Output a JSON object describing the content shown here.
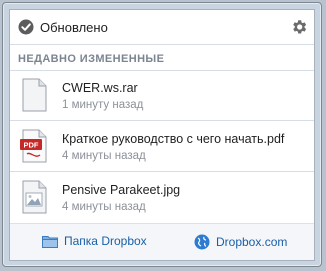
{
  "status": {
    "text": "Обновлено",
    "icon": "check-circle-icon"
  },
  "settings": {
    "icon": "gear-icon"
  },
  "recent": {
    "title": "НЕДАВНО ИЗМЕНЕННЫЕ",
    "files": [
      {
        "name": "CWER.ws.rar",
        "time": "1 минуту назад",
        "icon": "generic-file-icon"
      },
      {
        "name": "Краткое руководство с чего начать.pdf",
        "time": "4 минуты назад",
        "icon": "pdf-file-icon",
        "badge": "PDF"
      },
      {
        "name": "Pensive Parakeet.jpg",
        "time": "4 минуты назад",
        "icon": "image-file-icon"
      }
    ]
  },
  "footer": {
    "folder_link": "Папка Dropbox",
    "web_link": "Dropbox.com"
  },
  "colors": {
    "link": "#1a5fa8",
    "pdf_red": "#c62828"
  }
}
